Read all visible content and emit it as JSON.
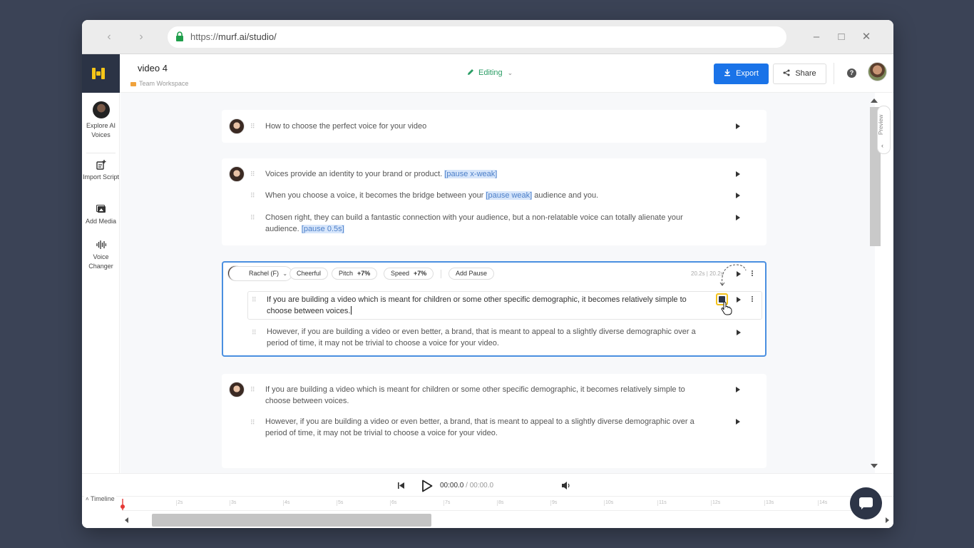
{
  "browser": {
    "url_protocol": "https://",
    "url_rest": "murf.ai/studio/"
  },
  "header": {
    "project_title": "video 4",
    "workspace": "Team Workspace",
    "mode": "Editing",
    "export_label": "Export",
    "share_label": "Share"
  },
  "sidebar": {
    "items": [
      {
        "label": "Explore AI Voices"
      },
      {
        "label": "Import Script"
      },
      {
        "label": "Add Media"
      },
      {
        "label": "Voice Changer"
      }
    ]
  },
  "blocks": [
    {
      "paragraphs": [
        {
          "text": "How to choose the perfect voice for your video"
        }
      ]
    },
    {
      "paragraphs": [
        {
          "before": "Voices provide an identity to your brand or product. ",
          "pause": "[pause x-weak]",
          "after": ""
        },
        {
          "before": "When you choose a voice, it becomes the bridge between your ",
          "pause": "[pause weak]",
          "after": " audience and you."
        },
        {
          "before": "Chosen right, they can build a fantastic connection with your audience, but a non-relatable voice can totally alienate your audience. ",
          "pause": "[pause 0.5s]",
          "after": ""
        }
      ]
    },
    {
      "voice": "Rachel (F)",
      "style": "Cheerful",
      "pitch_label": "Pitch",
      "pitch_value": "+7%",
      "speed_label": "Speed",
      "speed_value": "+7%",
      "add_pause": "Add Pause",
      "duration": "20.2s | 20.2s",
      "paragraphs": [
        {
          "text": "If you are building a video which is meant for children or some other specific demographic, it becomes relatively simple to choose between voices."
        },
        {
          "text": "However, if you are building a video or even better, a brand, that is meant to appeal to a slightly diverse demographic over a period of time, it may not be trivial to choose a voice for your video."
        }
      ]
    },
    {
      "paragraphs": [
        {
          "text": "If you are building a video which is meant for children or some other specific demographic, it becomes relatively simple to choose between voices."
        },
        {
          "text": "However, if you are building a video or even better, a brand, that is meant to appeal to a slightly diverse demographic over a period of time, it may not be trivial to choose a voice for your video."
        }
      ]
    }
  ],
  "preview_label": "Preview",
  "player": {
    "current": "00:00.0",
    "total": "/ 00:00.0"
  },
  "timeline": {
    "label": "Timeline",
    "ticks": [
      "2s",
      "3s",
      "4s",
      "5s",
      "6s",
      "7s",
      "8s",
      "9s",
      "10s",
      "11s",
      "12s",
      "13s",
      "14s"
    ]
  },
  "colors": {
    "accent": "#1a73e8",
    "editing": "#2a9d65",
    "logo": "#f5c518",
    "active_border": "#4a8fe0",
    "highlight": "#f3c21c"
  }
}
